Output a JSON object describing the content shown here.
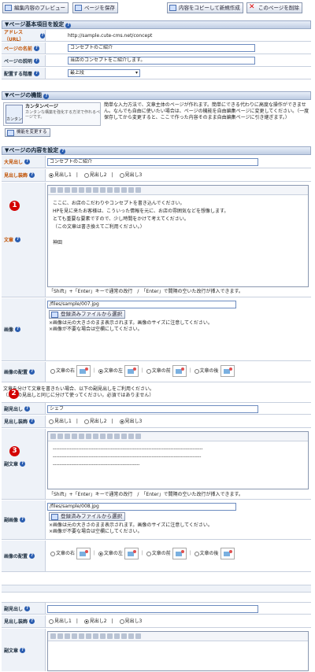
{
  "toolbar": {
    "preview": "編集内容のプレビュー",
    "save": "ページを保存",
    "copy": "内容をコピーして新規作成",
    "delete": "このページを削除"
  },
  "basic": {
    "title": "ページ基本項目を設定",
    "url_label": "アドレス（URL）",
    "url_value": "http://sample.cute-cms.net/concept",
    "name_label": "ページの名前",
    "name_value": "コンセプトのご紹介",
    "desc_label": "ページの説明",
    "desc_value": "当店のコンセプトをご紹介します。",
    "level_label": "配置する階層",
    "level_value": "最上段"
  },
  "feature": {
    "title": "ページの機能",
    "type_name": "カンタンページ",
    "type_desc": "カンタンな構築を強化する方法で作れるページです。",
    "icon_text": "カンタン",
    "change_button": "機能を変更する",
    "description": "簡単な入力方法で、文章主体のページが作れます。簡単にできる代わりに高度な操作ができません。なんでも自由に使いたい場合は、ページの機能を自由編集ページに変更してください。（一度保存してから変更すると、ここで作った内容そのまま自由編集ページに引き継ぎます。）"
  },
  "content": {
    "title": "ページの内容を設定",
    "heading_label": "大見出し",
    "heading_value": "コンセプトのご紹介",
    "heading_deco_label": "見出し装飾",
    "deco_options": [
      "見出し1",
      "見出し2",
      "見出し3"
    ],
    "body_label": "文章",
    "body_lines": [
      "ここに、お店のこだわりやコンセプトを書き込んでください。",
      "HPを見に来たお客様は、こういった情報を元に、お店の雰囲気などを想像します。",
      "とても重要な要素ですので、少し時間をかけて考えてください。",
      "（この文章は書き換えてご利用ください。）",
      "",
      "神田"
    ],
    "hint": "「Shift」+「Enter」キーで通常の改行　/　「Enter」で間隔の空いた改行が挿入できます。",
    "image_label": "画像",
    "image_value": "/files/sample/007.jpg",
    "image_button": "登録済みファイルから選択",
    "image_notes": [
      "画像は元の大きさのまま表示されます。画像のサイズに注意してください。",
      "画像が不要な場合は空欄にしてください。"
    ],
    "layout_label": "画像の配置",
    "layout_options": [
      "文章の右",
      "文章の左",
      "文章の前",
      "文章の後"
    ],
    "sub_note_1": "文章を分けて文章を書きたい場合、以下の副見出しをご利用ください。",
    "sub_note_2": "（上記の見出しと同じに分けて使ってください。必須ではありません）",
    "sub_heading_label": "副見出し",
    "sub_heading_value": "シェフ",
    "sub_body_label": "副文章",
    "sub_body_lines": [
      "----------------------------------------------------------------------------------------",
      "---------------------------------------------------------------------------------------",
      "---------------------------------------------------"
    ],
    "sub_image_label": "副画像",
    "sub_image_value": "/files/sample/008.jpg"
  },
  "markers": [
    "1",
    "2",
    "3"
  ]
}
